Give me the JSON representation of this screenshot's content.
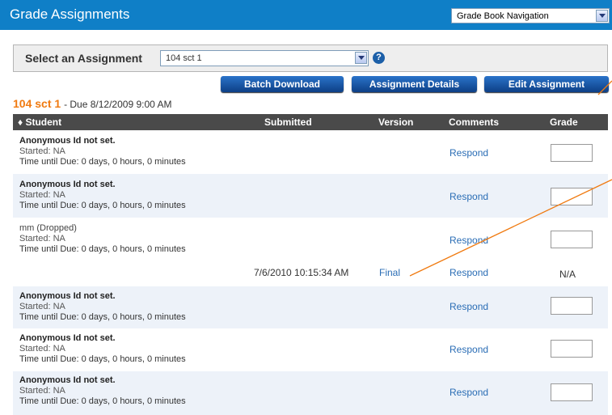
{
  "header": {
    "title": "Grade Assignments",
    "nav_select": "Grade Book Navigation"
  },
  "assignment_select": {
    "label": "Select an Assignment",
    "value": "104 sct 1"
  },
  "buttons": {
    "batch_download": "Batch Download",
    "assignment_details": "Assignment Details",
    "edit_assignment": "Edit Assignment"
  },
  "assignment": {
    "name": "104 sct 1",
    "due": "- Due 8/12/2009 9:00 AM"
  },
  "table": {
    "columns": [
      "♦ Student",
      "Submitted",
      "Version",
      "Comments",
      "Grade"
    ],
    "rows": [
      {
        "name": "Anonymous Id not set.",
        "started": "Started: NA",
        "due": "Time until Due: 0 days, 0 hours, 0 minutes",
        "comment": "Respond"
      },
      {
        "name": "Anonymous Id not set.",
        "started": "Started: NA",
        "due": "Time until Due: 0 days, 0 hours, 0 minutes",
        "comment": "Respond"
      },
      {
        "name": "mm (Dropped)",
        "started": "Started: NA",
        "due": "Time until Due: 0 days, 0 hours, 0 minutes",
        "comment": "Respond",
        "submitted": "7/6/2010 10:15:34 AM",
        "version": "Final",
        "comment2": "Respond",
        "grade": "N/A"
      },
      {
        "name": "Anonymous Id not set.",
        "started": "Started: NA",
        "due": "Time until Due: 0 days, 0 hours, 0 minutes",
        "comment": "Respond"
      },
      {
        "name": "Anonymous Id not set.",
        "started": "Started: NA",
        "due": "Time until Due: 0 days, 0 hours, 0 minutes",
        "comment": "Respond"
      },
      {
        "name": "Anonymous Id not set.",
        "started": "Started: NA",
        "due": "Time until Due: 0 days, 0 hours, 0 minutes",
        "comment": "Respond"
      }
    ]
  },
  "colors": {
    "header_bg": "#0f7fc7",
    "button_bg": "#0d3f86",
    "accent_orange": "#f07a10",
    "link_blue": "#2a6db5",
    "table_head": "#4a4a4a",
    "row_alt": "#edf2f9"
  }
}
